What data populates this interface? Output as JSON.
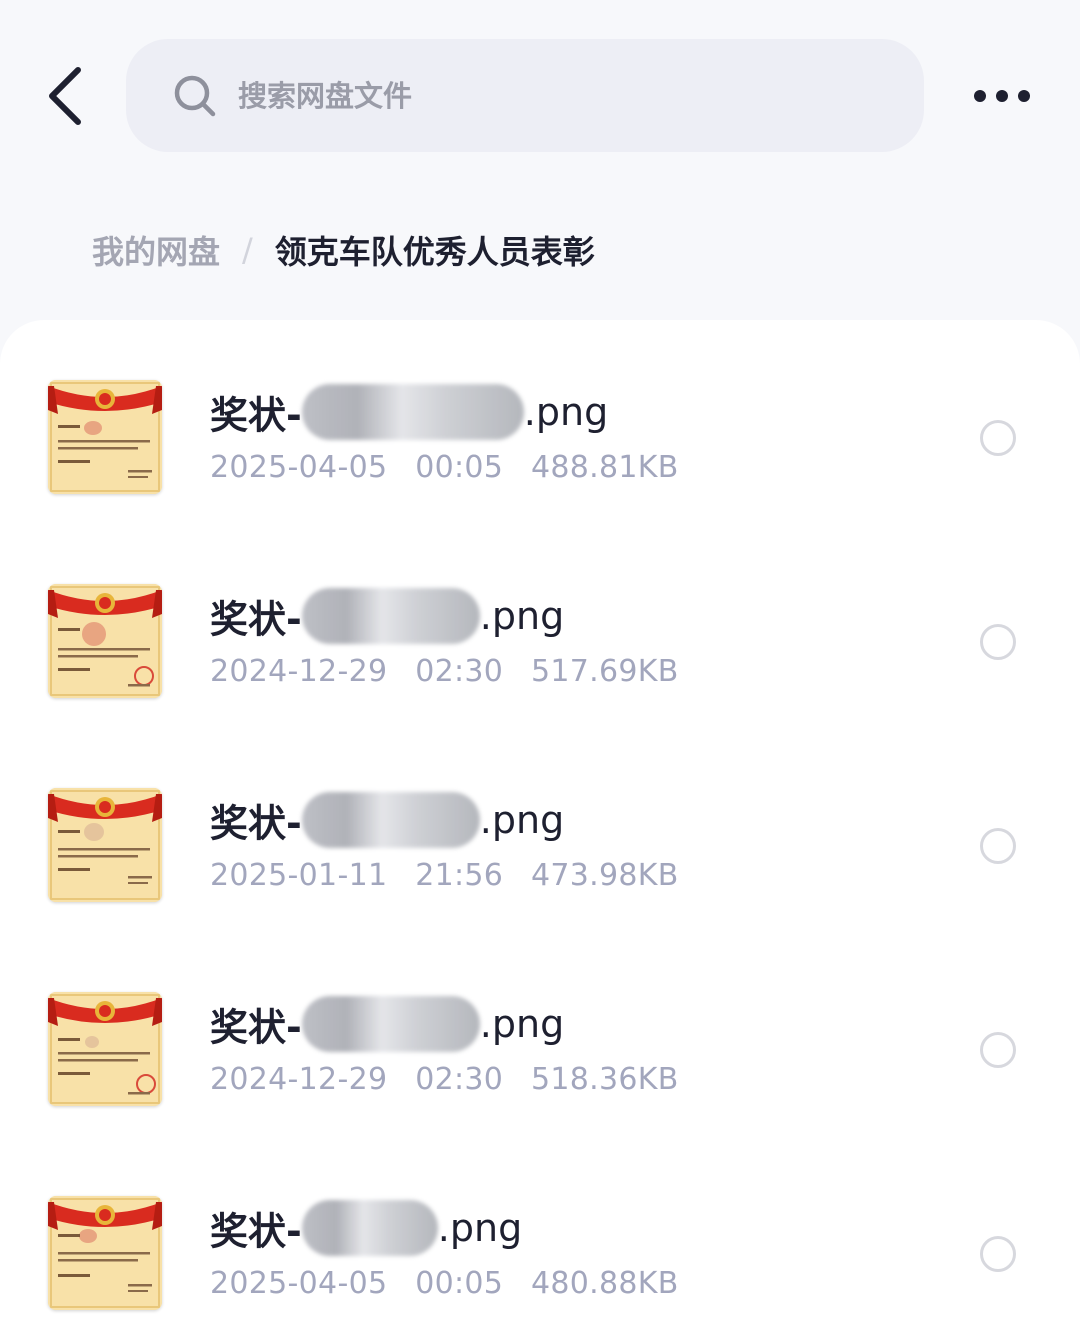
{
  "header": {
    "search_placeholder": "搜索网盘文件",
    "icons": {
      "back": "chevron-left-icon",
      "search": "search-icon",
      "more": "more-horizontal-icon"
    }
  },
  "breadcrumb": {
    "root": "我的网盘",
    "separator": "/",
    "current": "领克车队优秀人员表彰"
  },
  "colors": {
    "title": "#1e2030",
    "meta": "#a2a6bd",
    "crumb_root": "#a4a6b3",
    "search_bg": "#edeef5",
    "radio_border": "#d7d8de"
  },
  "files": [
    {
      "name_prefix": "奖状-",
      "name_suffix": ".png",
      "date": "2025-04-05",
      "time": "00:05",
      "size": "488.81KB"
    },
    {
      "name_prefix": "奖状-",
      "name_suffix": ".png",
      "date": "2024-12-29",
      "time": "02:30",
      "size": "517.69KB"
    },
    {
      "name_prefix": "奖状-",
      "name_suffix": ".png",
      "date": "2025-01-11",
      "time": "21:56",
      "size": "473.98KB"
    },
    {
      "name_prefix": "奖状-",
      "name_suffix": ".png",
      "date": "2024-12-29",
      "time": "02:30",
      "size": "518.36KB"
    },
    {
      "name_prefix": "奖状-",
      "name_suffix": ".png",
      "date": "2025-04-05",
      "time": "00:05",
      "size": "480.88KB"
    }
  ]
}
